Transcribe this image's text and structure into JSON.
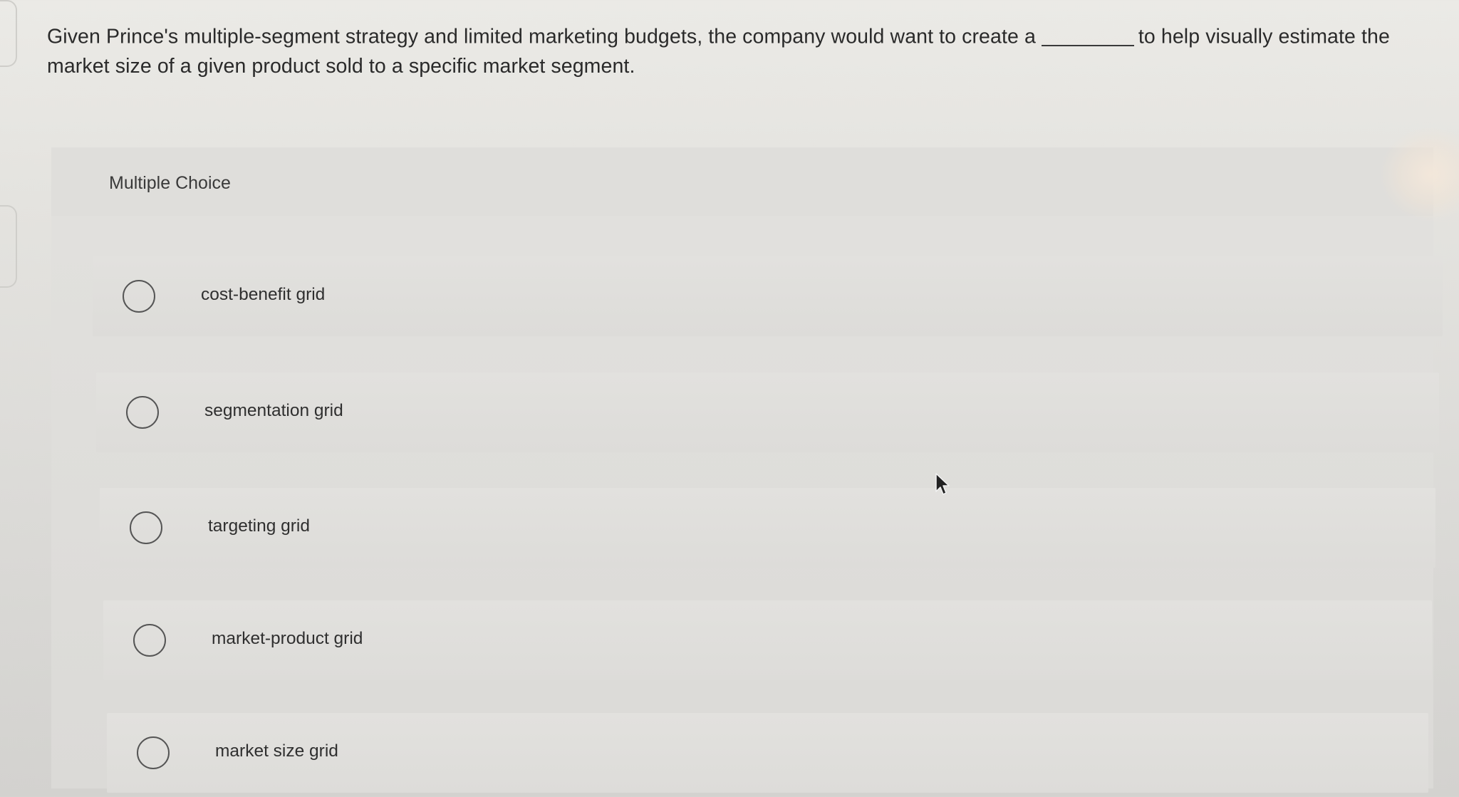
{
  "question": {
    "before_blank": "Given Prince's multiple-segment strategy and limited marketing budgets, the company would want to create a",
    "after_blank": "to help visually estimate the market size of a given product sold to a specific market segment."
  },
  "multiple_choice": {
    "title": "Multiple Choice",
    "options": [
      {
        "label": "cost-benefit grid"
      },
      {
        "label": "segmentation grid"
      },
      {
        "label": "targeting grid"
      },
      {
        "label": "market-product grid"
      },
      {
        "label": "market size grid"
      }
    ]
  },
  "colors": {
    "background": "#e4e3df",
    "panel": "#dfdedb",
    "text": "#2a2a2a",
    "radio_border": "#555555"
  }
}
